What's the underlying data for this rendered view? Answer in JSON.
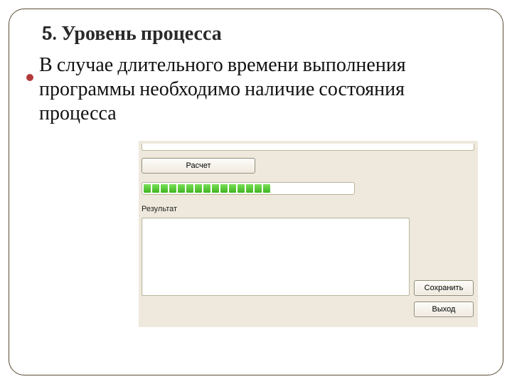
{
  "slide": {
    "title": "5. Уровень процесса",
    "bullet_text": "В случае длительного времени выполнения программы необходимо наличие состояния процесса"
  },
  "panel": {
    "calc_button": "Расчет",
    "result_label": "Результат",
    "save_button": "Сохранить",
    "exit_button": "Выход",
    "progress_segments": 15
  }
}
